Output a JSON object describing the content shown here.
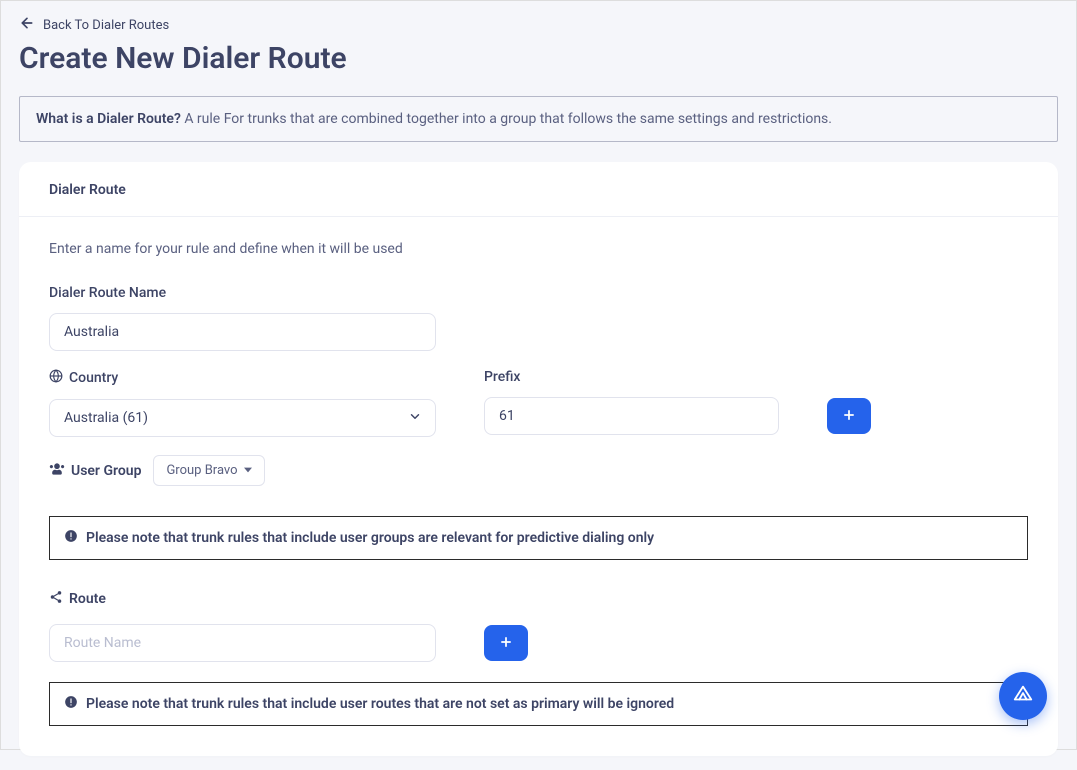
{
  "back_link": "Back To Dialer Routes",
  "page_title": "Create New Dialer Route",
  "info": {
    "question": "What is a Dialer Route?",
    "answer": "A rule For trunks that are combined together into a group that follows the same settings and restrictions."
  },
  "card": {
    "header": "Dialer Route",
    "intro": "Enter a name for your rule and define when it will be used",
    "name_label": "Dialer Route Name",
    "name_value": "Australia",
    "country_label": "Country",
    "country_value": "Australia (61)",
    "prefix_label": "Prefix",
    "prefix_value": "61",
    "user_group_label": "User Group",
    "user_group_value": "Group Bravo",
    "warning1": "Please note that trunk rules that include user groups are relevant for predictive dialing only",
    "route_label": "Route",
    "route_placeholder": "Route Name",
    "warning2": "Please note that trunk rules that include user routes that are not set as primary will be ignored"
  }
}
